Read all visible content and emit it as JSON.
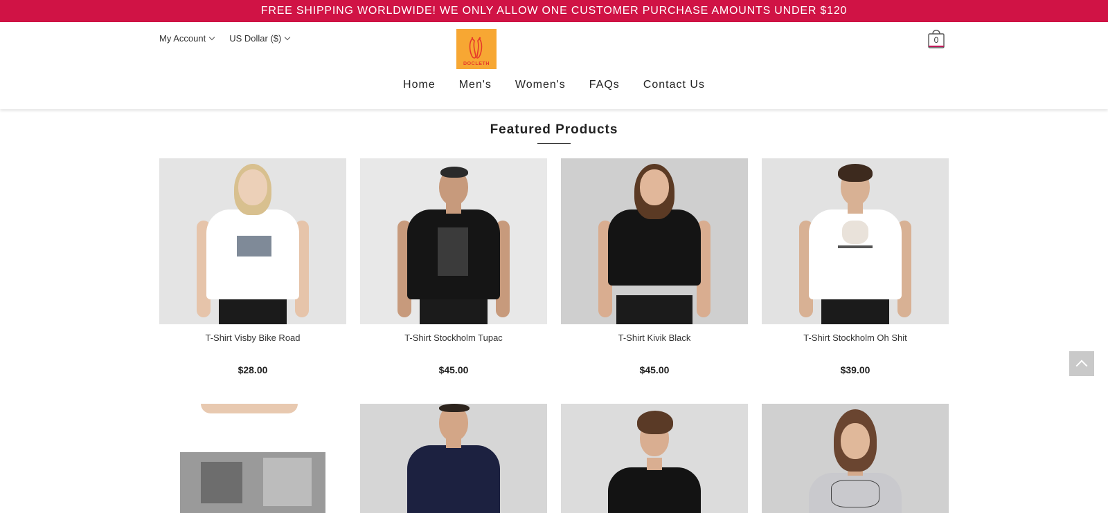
{
  "announcement": "FREE SHIPPING WORLDWIDE! WE ONLY ALLOW ONE CUSTOMER PURCHASE AMOUNTS UNDER $120",
  "header": {
    "account_label": "My Account",
    "currency_label": "US Dollar ($)",
    "logo_text": "DOCLETH",
    "cart_count": "0"
  },
  "nav": [
    "Home",
    "Men's",
    "Women's",
    "FAQs",
    "Contact Us"
  ],
  "section_title": "Featured Products",
  "products": [
    {
      "name": "T-Shirt Visby Bike Road",
      "price": "$28.00",
      "shirt_color": "#ffffff"
    },
    {
      "name": "T-Shirt Stockholm Tupac",
      "price": "$45.00",
      "shirt_color": "#151515"
    },
    {
      "name": "T-Shirt Kivik Black",
      "price": "$45.00",
      "shirt_color": "#141414"
    },
    {
      "name": "T-Shirt Stockholm Oh Shit",
      "price": "$39.00",
      "shirt_color": "#ffffff"
    },
    {
      "name": "",
      "price": "",
      "shirt_color": "#ffffff"
    },
    {
      "name": "",
      "price": "",
      "shirt_color": "#1c2140"
    },
    {
      "name": "",
      "price": "",
      "shirt_color": "#131313"
    },
    {
      "name": "",
      "price": "",
      "shirt_color": "#c9c9cd"
    }
  ],
  "colors": {
    "announcement_bg": "#d01345",
    "logo_bg": "#f7a733",
    "cart_accent": "#c0185a"
  }
}
